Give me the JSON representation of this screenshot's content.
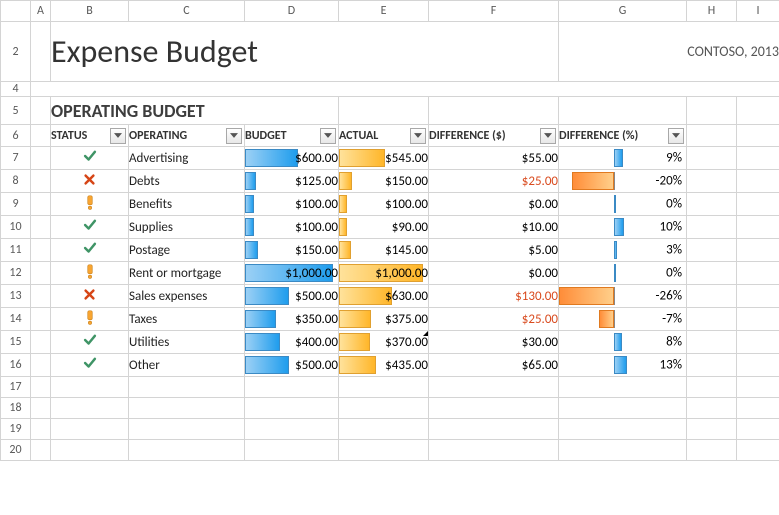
{
  "columns": [
    "A",
    "B",
    "C",
    "D",
    "E",
    "F",
    "G",
    "H",
    "I"
  ],
  "col_widths": {
    "A": 20,
    "B": 78,
    "C": 116,
    "D": 94,
    "E": 90,
    "F": 130,
    "G": 128,
    "H": 50,
    "I": 43
  },
  "row_heads": [
    "2",
    "4",
    "5",
    "6",
    "7",
    "8",
    "9",
    "10",
    "11",
    "12",
    "13",
    "14",
    "15",
    "16",
    "17",
    "18",
    "19",
    "20"
  ],
  "title": "Expense Budget",
  "company": "CONTOSO, 2013",
  "section": "OPERATING BUDGET",
  "headers": {
    "status": "STATUS",
    "operating": "OPERATING",
    "budget": "BUDGET",
    "actual": "ACTUAL",
    "diff_dollar": "DIFFERENCE ($)",
    "diff_pct": "DIFFERENCE (%)"
  },
  "max_budget": 1000,
  "max_actual": 1000,
  "pct_axis_pos": 55,
  "pct_scale": 26,
  "rows": [
    {
      "status": "ok",
      "name": "Advertising",
      "budget": "$600.00",
      "budget_v": 600,
      "actual": "$545.00",
      "actual_v": 545,
      "diff": "$55.00",
      "diff_neg": false,
      "pct": "9%",
      "pct_v": 9
    },
    {
      "status": "bad",
      "name": "Debts",
      "budget": "$125.00",
      "budget_v": 125,
      "actual": "$150.00",
      "actual_v": 150,
      "diff": "$25.00",
      "diff_neg": true,
      "pct": "-20%",
      "pct_v": -20
    },
    {
      "status": "warn",
      "name": "Benefits",
      "budget": "$100.00",
      "budget_v": 100,
      "actual": "$100.00",
      "actual_v": 100,
      "diff": "$0.00",
      "diff_neg": false,
      "pct": "0%",
      "pct_v": 0
    },
    {
      "status": "ok",
      "name": "Supplies",
      "budget": "$100.00",
      "budget_v": 100,
      "actual": "$90.00",
      "actual_v": 90,
      "diff": "$10.00",
      "diff_neg": false,
      "pct": "10%",
      "pct_v": 10
    },
    {
      "status": "ok",
      "name": "Postage",
      "budget": "$150.00",
      "budget_v": 150,
      "actual": "$145.00",
      "actual_v": 145,
      "diff": "$5.00",
      "diff_neg": false,
      "pct": "3%",
      "pct_v": 3
    },
    {
      "status": "warn",
      "name": "Rent or mortgage",
      "budget": "$1,000.00",
      "budget_v": 1000,
      "actual": "$1,000.00",
      "actual_v": 1000,
      "diff": "$0.00",
      "diff_neg": false,
      "pct": "0%",
      "pct_v": 0
    },
    {
      "status": "bad",
      "name": "Sales expenses",
      "budget": "$500.00",
      "budget_v": 500,
      "actual": "$630.00",
      "actual_v": 630,
      "diff": "$130.00",
      "diff_neg": true,
      "pct": "-26%",
      "pct_v": -26
    },
    {
      "status": "warn",
      "name": "Taxes",
      "budget": "$350.00",
      "budget_v": 350,
      "actual": "$375.00",
      "actual_v": 375,
      "diff": "$25.00",
      "diff_neg": true,
      "pct": "-7%",
      "pct_v": -7
    },
    {
      "status": "ok",
      "name": "Utilities",
      "budget": "$400.00",
      "budget_v": 400,
      "actual": "$370.00",
      "actual_v": 370,
      "diff": "$30.00",
      "diff_neg": false,
      "pct": "8%",
      "pct_v": 8
    },
    {
      "status": "ok",
      "name": "Other",
      "budget": "$500.00",
      "budget_v": 500,
      "actual": "$435.00",
      "actual_v": 435,
      "diff": "$65.00",
      "diff_neg": false,
      "pct": "13%",
      "pct_v": 13
    }
  ],
  "chart_data": {
    "type": "table",
    "title": "Operating Budget",
    "columns": [
      "STATUS",
      "OPERATING",
      "BUDGET",
      "ACTUAL",
      "DIFFERENCE ($)",
      "DIFFERENCE (%)"
    ],
    "rows": [
      [
        "ok",
        "Advertising",
        600.0,
        545.0,
        55.0,
        9
      ],
      [
        "bad",
        "Debts",
        125.0,
        150.0,
        -25.0,
        -20
      ],
      [
        "warn",
        "Benefits",
        100.0,
        100.0,
        0.0,
        0
      ],
      [
        "ok",
        "Supplies",
        100.0,
        90.0,
        10.0,
        10
      ],
      [
        "ok",
        "Postage",
        150.0,
        145.0,
        5.0,
        3
      ],
      [
        "warn",
        "Rent or mortgage",
        1000.0,
        1000.0,
        0.0,
        0
      ],
      [
        "bad",
        "Sales expenses",
        500.0,
        630.0,
        -130.0,
        -26
      ],
      [
        "warn",
        "Taxes",
        350.0,
        375.0,
        -25.0,
        -7
      ],
      [
        "ok",
        "Utilities",
        400.0,
        370.0,
        30.0,
        8
      ],
      [
        "ok",
        "Other",
        500.0,
        435.0,
        65.0,
        13
      ]
    ]
  }
}
